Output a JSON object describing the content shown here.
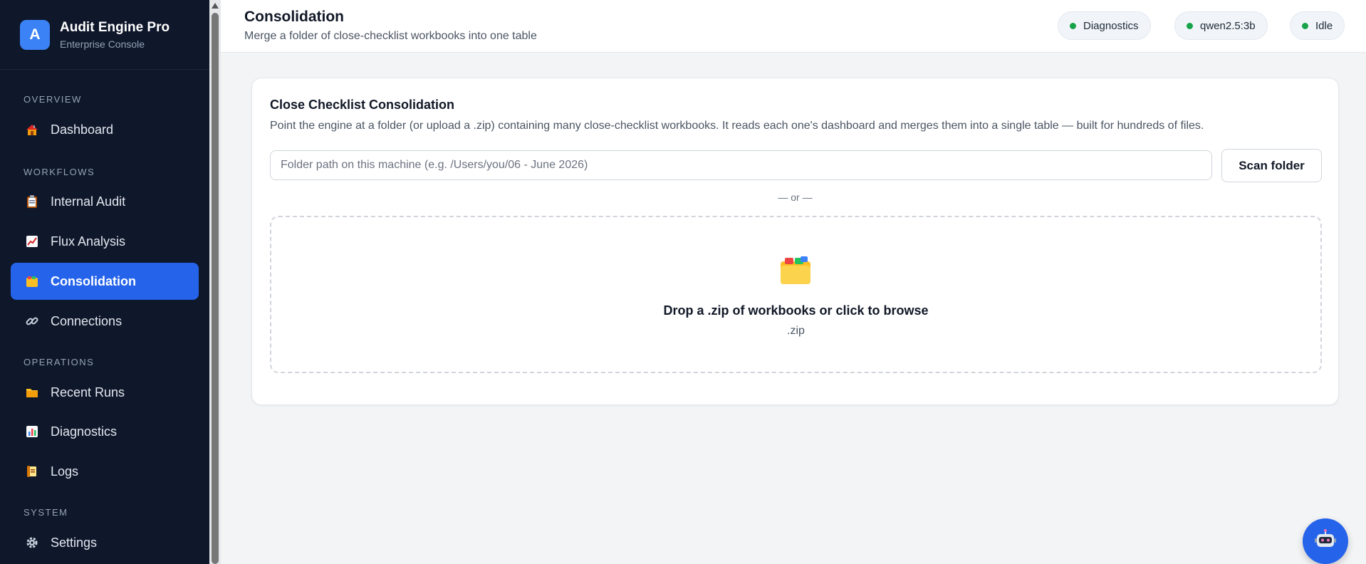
{
  "brand": {
    "logo_letter": "A",
    "title": "Audit Engine Pro",
    "subtitle": "Enterprise Console"
  },
  "sidebar": {
    "sections": [
      {
        "label": "OVERVIEW"
      },
      {
        "label": "WORKFLOWS"
      },
      {
        "label": "OPERATIONS"
      },
      {
        "label": "SYSTEM"
      }
    ],
    "items": [
      {
        "label": "Dashboard",
        "icon": "house-icon"
      },
      {
        "label": "Internal Audit",
        "icon": "clipboard-icon"
      },
      {
        "label": "Flux Analysis",
        "icon": "chart-increasing-icon"
      },
      {
        "label": "Consolidation",
        "icon": "card-index-dividers-icon",
        "active": true
      },
      {
        "label": "Connections",
        "icon": "link-icon"
      },
      {
        "label": "Recent Runs",
        "icon": "folder-icon"
      },
      {
        "label": "Diagnostics",
        "icon": "bar-chart-icon"
      },
      {
        "label": "Logs",
        "icon": "scroll-icon"
      },
      {
        "label": "Settings",
        "icon": "gear-icon"
      }
    ]
  },
  "header": {
    "title": "Consolidation",
    "subtitle": "Merge a folder of close-checklist workbooks into one table",
    "status_pills": [
      {
        "label": "Diagnostics",
        "status_color": "#16a34a"
      },
      {
        "label": "qwen2.5:3b",
        "status_color": "#16a34a"
      },
      {
        "label": "Idle",
        "status_color": "#16a34a"
      }
    ]
  },
  "card": {
    "title": "Close Checklist Consolidation",
    "description": "Point the engine at a folder (or upload a .zip) containing many close-checklist workbooks. It reads each one's dashboard and merges them into a single table — built for hundreds of files.",
    "folder_input": {
      "value": "",
      "placeholder": "Folder path on this machine (e.g. /Users/you/06 - June 2026)"
    },
    "scan_button": "Scan folder",
    "or_divider": "— or —",
    "dropzone": {
      "icon": "card-index-dividers-icon",
      "label": "Drop a .zip of workbooks or click to browse",
      "hint": ".zip"
    }
  },
  "assistant": {
    "icon": "robot-icon"
  },
  "colors": {
    "sidebar_bg": "#0f172a",
    "accent": "#2563eb",
    "status_ok": "#16a34a"
  }
}
